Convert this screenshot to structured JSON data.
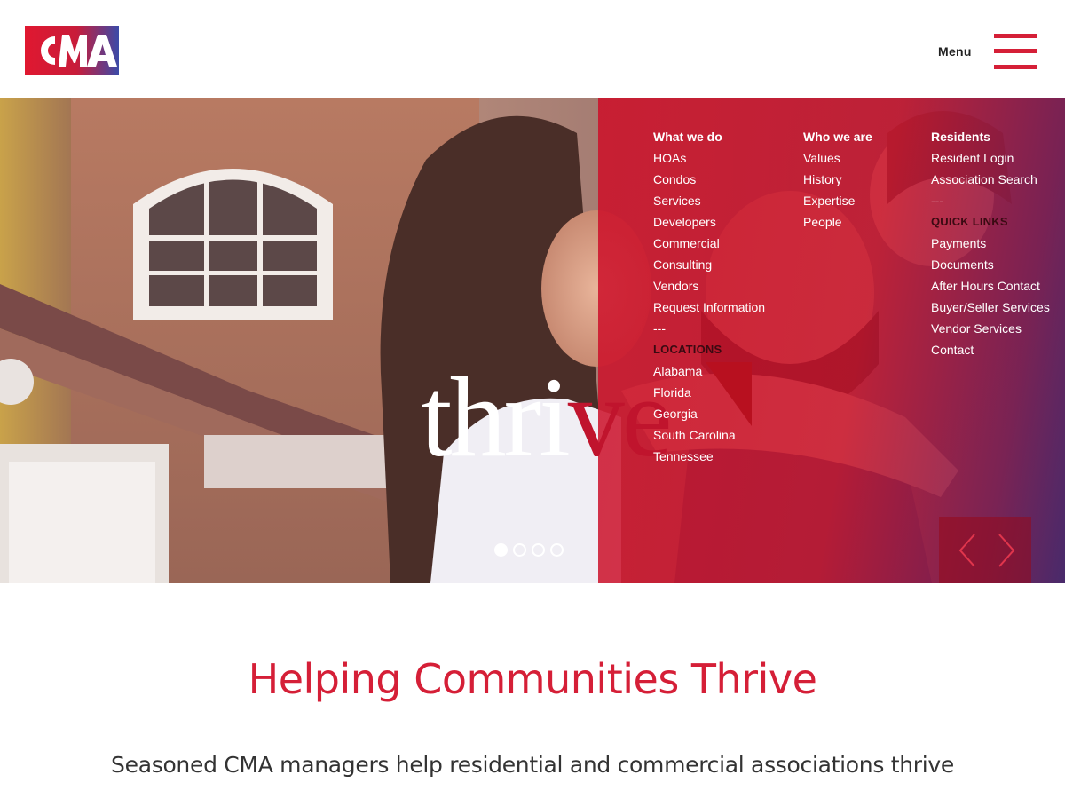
{
  "header": {
    "logo_text": "CMA",
    "menu_label": "Menu"
  },
  "hero": {
    "word_part1": "thri",
    "word_part2": "ve",
    "slider": {
      "slide_count": 4,
      "active_slide": 1
    }
  },
  "nav": {
    "col1": {
      "heading": "What we do",
      "links": [
        "HOAs",
        "Condos",
        "Services",
        "Developers",
        "Commercial",
        "Consulting",
        "Vendors",
        "Request Information"
      ],
      "separator": "---",
      "subheading": "LOCATIONS",
      "locations": [
        "Alabama",
        "Florida",
        "Georgia",
        "South Carolina",
        "Tennessee"
      ]
    },
    "col2": {
      "heading": "Who we are",
      "links": [
        "Values",
        "History",
        "Expertise",
        "People"
      ]
    },
    "col3": {
      "heading": "Residents",
      "links": [
        "Resident Login",
        "Association Search"
      ],
      "separator": "---",
      "subheading": "QUICK LINKS",
      "quick_links": [
        "Payments",
        "Documents",
        "After Hours Contact",
        "Buyer/Seller Services",
        "Vendor Services",
        "Contact"
      ]
    }
  },
  "main": {
    "headline": "Helping Communities Thrive",
    "subline": "Seasoned CMA managers help residential and commercial associations thrive"
  },
  "colors": {
    "brand_red": "#d51f37",
    "brand_blue": "#3b4aa8",
    "overlay_red": "#cd0f28"
  }
}
